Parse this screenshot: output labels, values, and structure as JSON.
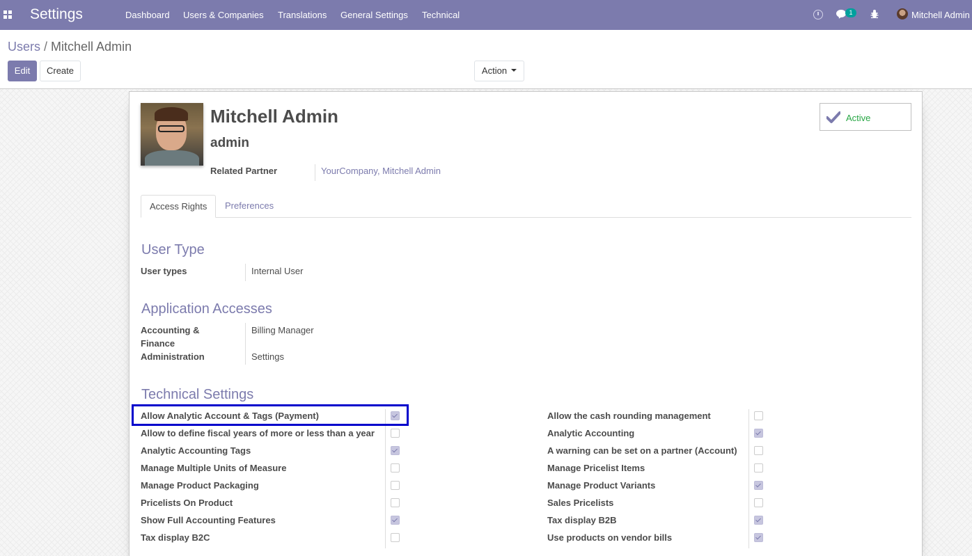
{
  "app": {
    "title": "Settings"
  },
  "nav": {
    "menu": [
      "Dashboard",
      "Users & Companies",
      "Translations",
      "General Settings",
      "Technical"
    ],
    "chat_count": "1",
    "user_name": "Mitchell Admin",
    "icons": [
      "apps-icon",
      "clock-icon",
      "chat-icon",
      "bug-icon",
      "avatar"
    ]
  },
  "breadcrumb": {
    "parent": "Users",
    "separator": "/",
    "current": "Mitchell Admin"
  },
  "buttons": {
    "edit": "Edit",
    "create": "Create",
    "action": "Action"
  },
  "record": {
    "name": "Mitchell Admin",
    "login": "admin",
    "related_partner_label": "Related Partner",
    "related_partner_value": "YourCompany, Mitchell Admin",
    "status": "Active"
  },
  "tabs": [
    "Access Rights",
    "Preferences"
  ],
  "sections": {
    "user_type": {
      "title": "User Type",
      "label": "User types",
      "value": "Internal User"
    },
    "app_access": {
      "title": "Application Accesses",
      "rows": [
        {
          "label_line1": "Accounting &",
          "label_line2": "Finance",
          "value": "Billing Manager"
        },
        {
          "label_line1": "Administration",
          "value": "Settings"
        }
      ]
    },
    "technical": {
      "title": "Technical Settings",
      "left": [
        {
          "label": "Allow Analytic Account & Tags (Payment)",
          "checked": true
        },
        {
          "label": "Allow to define fiscal years of more or less than a year",
          "checked": false
        },
        {
          "label": "Analytic Accounting Tags",
          "checked": true
        },
        {
          "label": "Manage Multiple Units of Measure",
          "checked": false
        },
        {
          "label": "Manage Product Packaging",
          "checked": false
        },
        {
          "label": "Pricelists On Product",
          "checked": false
        },
        {
          "label": "Show Full Accounting Features",
          "checked": true
        },
        {
          "label": "Tax display B2C",
          "checked": false
        }
      ],
      "right": [
        {
          "label": "Allow the cash rounding management",
          "checked": false
        },
        {
          "label": "Analytic Accounting",
          "checked": true
        },
        {
          "label": "A warning can be set on a partner (Account)",
          "checked": false
        },
        {
          "label": "Manage Pricelist Items",
          "checked": false
        },
        {
          "label": "Manage Product Variants",
          "checked": true
        },
        {
          "label": "Sales Pricelists",
          "checked": false
        },
        {
          "label": "Tax display B2B",
          "checked": true
        },
        {
          "label": "Use products on vendor bills",
          "checked": true
        }
      ]
    }
  },
  "colors": {
    "brand": "#7c7bad",
    "active_status": "#28a745",
    "highlight": "#0000cc"
  }
}
